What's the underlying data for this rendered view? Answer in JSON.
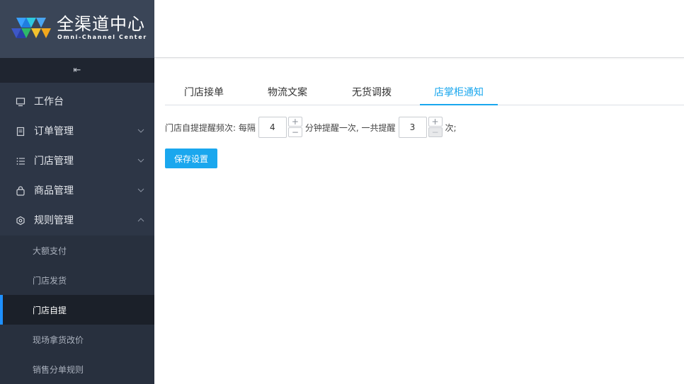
{
  "logo": {
    "title": "全渠道中心",
    "subtitle": "Omni-Channel Center"
  },
  "sidebar": {
    "collapse_icon": "indent-icon",
    "items": [
      {
        "label": "工作台",
        "icon": "monitor-icon"
      },
      {
        "label": "订单管理",
        "icon": "document-icon",
        "arrow": "down"
      },
      {
        "label": "门店管理",
        "icon": "list-icon",
        "arrow": "down"
      },
      {
        "label": "商品管理",
        "icon": "bag-icon",
        "arrow": "down"
      },
      {
        "label": "规则管理",
        "icon": "cog-icon",
        "arrow": "up"
      }
    ],
    "subitems": [
      {
        "label": "大额支付"
      },
      {
        "label": "门店发货"
      },
      {
        "label": "门店自提",
        "active": true
      },
      {
        "label": "现场拿货改价"
      },
      {
        "label": "销售分单规则"
      }
    ]
  },
  "tabs": [
    {
      "label": "门店接单"
    },
    {
      "label": "物流文案"
    },
    {
      "label": "无货调拨"
    },
    {
      "label": "店掌柜通知",
      "active": true
    }
  ],
  "form": {
    "prefix": "门店自提提醒频次: 每隔",
    "interval_value": "4",
    "middle": "分钟提醒一次, 一共提醒",
    "count_value": "3",
    "suffix": "次;",
    "plus": "+",
    "minus": "−"
  },
  "save_label": "保存设置",
  "colors": {
    "accent": "#1aa7ee",
    "sidebar": "#2d3646",
    "active_bar": "#1e90ff"
  }
}
